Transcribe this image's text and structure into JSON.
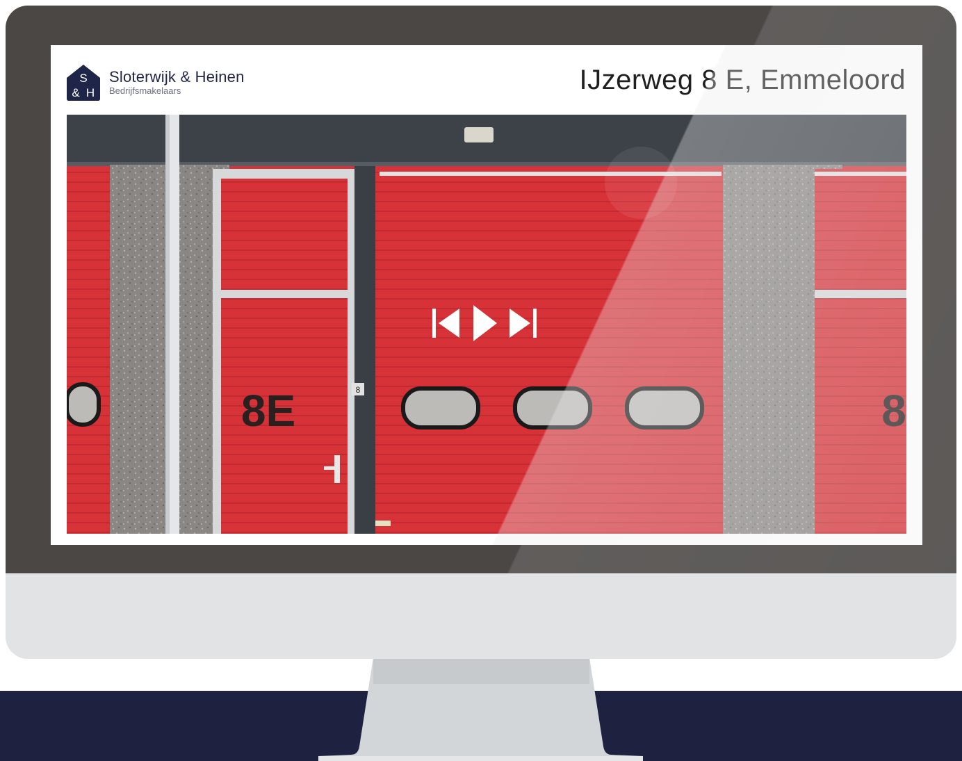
{
  "brand": {
    "name": "Sloterwijk & Heinen",
    "tagline": "Bedrijfsmakelaars",
    "logo_letters": "S&H"
  },
  "listing": {
    "address": "IJzerweg 8 E, Emmeloord"
  },
  "photo": {
    "door_label_left": "8E",
    "door_label_right": "8",
    "door_plate": "8"
  },
  "player": {
    "prev_icon": "skip-previous-icon",
    "play_icon": "play-icon",
    "next_icon": "skip-next-icon"
  },
  "colors": {
    "brand_navy": "#1f2548",
    "door_red": "#d73238",
    "bezel": "#4a4745",
    "desk": "#1e2240"
  }
}
